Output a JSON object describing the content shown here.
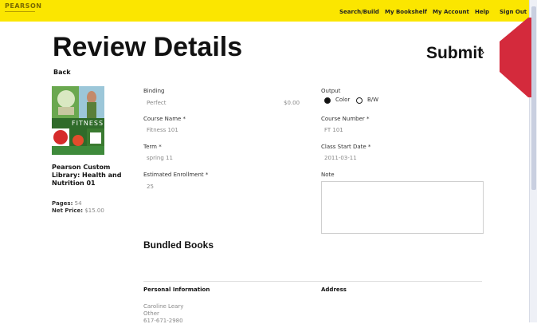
{
  "header": {
    "brand": "PEARSON",
    "nav": [
      "Search/Build",
      "My Bookshelf",
      "My Account",
      "Help",
      "Sign Out"
    ]
  },
  "page": {
    "title": "Review Details",
    "back_label": "Back",
    "submit_label": "Submit",
    "submit_arrow": "›"
  },
  "book": {
    "cover_text": "FITNESS",
    "title": "Pearson Custom Library: Health and Nutrition 01",
    "pages_label": "Pages:",
    "pages_value": "54",
    "price_label": "Net Price:",
    "price_value": "$15.00"
  },
  "form": {
    "binding_label": "Binding",
    "binding_value": "Perfect",
    "binding_price": "$0.00",
    "output_label": "Output",
    "output_options": [
      "Color",
      "B/W"
    ],
    "output_selected": "Color",
    "course_name_label": "Course Name *",
    "course_name_value": "Fitness 101",
    "course_number_label": "Course Number *",
    "course_number_value": "FT 101",
    "term_label": "Term *",
    "term_value": "spring 11",
    "class_start_label": "Class Start Date *",
    "class_start_value": "2011-03-11",
    "enrollment_label": "Estimated Enrollment *",
    "enrollment_value": "25",
    "note_label": "Note",
    "note_value": ""
  },
  "bundled": {
    "title": "Bundled Books"
  },
  "personal": {
    "title": "Personal Information",
    "address_title": "Address",
    "name": "Caroline Leary",
    "role": "Other",
    "phone": "617-671-2980"
  },
  "colors": {
    "topbar": "#fbe600",
    "accent_red": "#d42a3c"
  }
}
